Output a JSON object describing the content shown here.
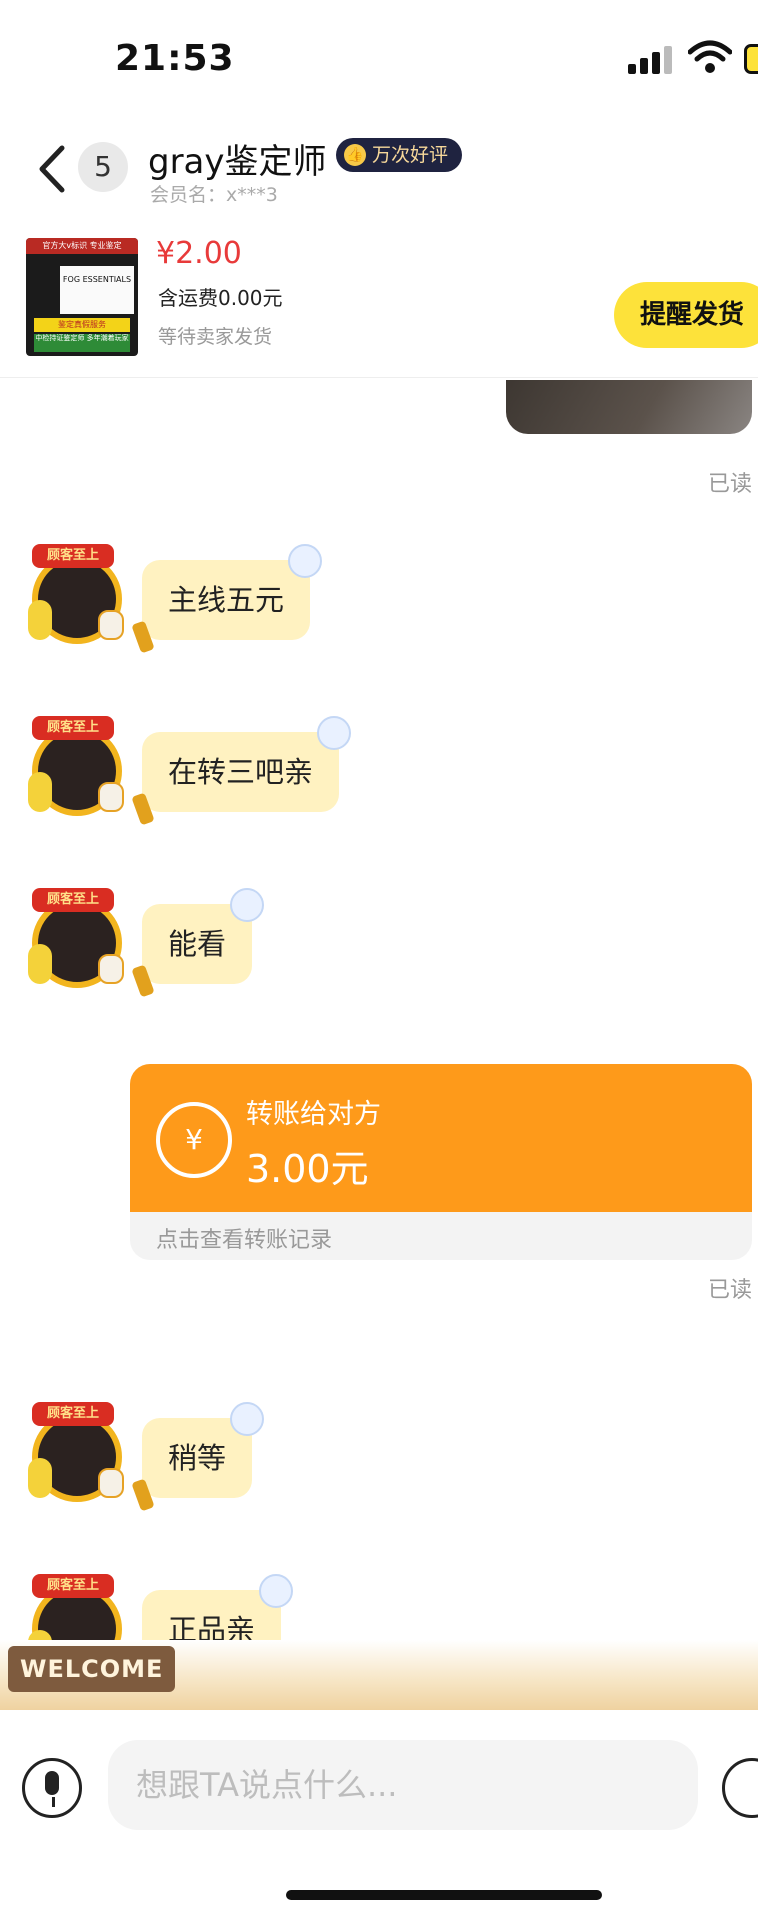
{
  "status_bar": {
    "time": "21:53"
  },
  "header": {
    "unread_count": "5",
    "shop_name": "gray鉴定师",
    "rating_badge": "万次好评",
    "member": "会员名：x***3"
  },
  "product": {
    "thumbnail_text": {
      "top": "官方大v标识 专业鉴定",
      "brand": "FOG ESSENTIALS",
      "line1": "鉴定真假服务",
      "line2": "中检持证鉴定师 多年潮着玩家"
    },
    "price": "¥2.00",
    "shipping": "含运费0.00元",
    "status": "等待卖家发货",
    "remind_button": "提醒发货"
  },
  "avatar": {
    "banner_text": "顾客至上"
  },
  "messages": [
    {
      "type": "read",
      "text": "已读"
    },
    {
      "type": "incoming",
      "text": "主线五元"
    },
    {
      "type": "incoming",
      "text": "在转三吧亲"
    },
    {
      "type": "incoming",
      "text": "能看"
    },
    {
      "type": "transfer",
      "title": "转账给对方",
      "amount": "3.00元",
      "link": "点击查看转账记录",
      "read": "已读"
    },
    {
      "type": "incoming",
      "text": "稍等"
    },
    {
      "type": "incoming",
      "text": "正品亲"
    }
  ],
  "welcome_tag": "WELCOME",
  "input": {
    "placeholder": "想跟TA说点什么..."
  },
  "colors": {
    "accent_yellow": "#fde23a",
    "transfer_orange": "#fe9a1a",
    "price_red": "#e83a3a",
    "bubble": "#fff2c1"
  },
  "icons": [
    "signal-icon",
    "wifi-icon",
    "battery-icon",
    "back-arrow-icon",
    "thumbs-up-icon",
    "yen-exchange-icon",
    "microphone-icon",
    "emoji-icon"
  ]
}
